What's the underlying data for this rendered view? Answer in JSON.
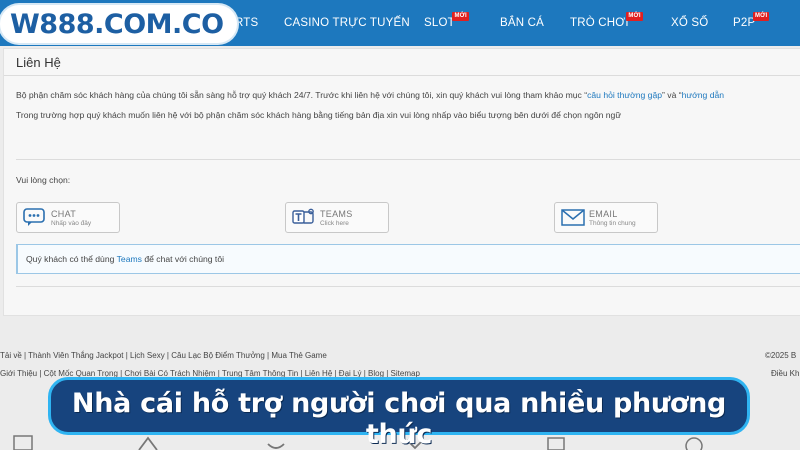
{
  "header": {
    "logo_text": "W888.COM.CO",
    "nav": [
      {
        "label": "RTS",
        "badge": ""
      },
      {
        "label": "CASINO TRỰC TUYẾN",
        "badge": ""
      },
      {
        "label": "SLOT",
        "badge": "MỚI"
      },
      {
        "label": "BẮN CÁ",
        "badge": ""
      },
      {
        "label": "TRÒ CHƠI",
        "badge": "MỚI"
      },
      {
        "label": "XỔ SỐ",
        "badge": ""
      },
      {
        "label": "P2P",
        "badge": "MỚI"
      }
    ]
  },
  "contact": {
    "title": "Liên Hệ",
    "para1_prefix": "Bộ phận chăm sóc khách hàng của chúng tôi sẵn sàng hỗ trợ quý khách 24/7. Trước khi liên hệ với chúng tôi, xin quý khách vui lòng tham khảo mục “",
    "para1_link1": "câu hỏi thường gặp",
    "para1_mid": "” và “",
    "para1_link2": "hướng dẫn",
    "para2": "Trong trường hợp quý khách muốn liên hệ với bộ phận chăm sóc khách hàng bằng tiếng bản địa xin vui lòng nhấp vào biểu tượng bên dưới để chọn ngôn ngữ",
    "choose_label": "Vui lòng chọn:",
    "options": [
      {
        "title": "CHAT",
        "sub": "Nhấp vào đây",
        "icon": "chat-icon"
      },
      {
        "title": "TEAMS",
        "sub": "Click here",
        "icon": "teams-icon"
      },
      {
        "title": "EMAIL",
        "sub": "Thông tin chung",
        "icon": "email-icon"
      }
    ],
    "notice_prefix": "Quý khách có thể dùng ",
    "notice_link": "Teams",
    "notice_suffix": " để chat với chúng tôi"
  },
  "footer": {
    "row1": "Tải về  |  Thành Viên Thắng Jackpot  |  Lịch Sexy  |  Câu Lạc Bộ Điểm Thưởng  |  Mua Thẻ Game",
    "row2": "Giới Thiệu  |  Cột Mốc Quan Trọng  |  Chơi Bài Có Trách Nhiệm  |  Trung Tâm Thông Tin  |  Liên Hệ  |  Đại Lý  |  Blog  |  Sitemap",
    "right1": "©2025 B",
    "right2": "Điều Kh"
  },
  "banner": {
    "text": "Nhà cái hỗ trợ người chơi qua nhiều phương thức"
  },
  "colors": {
    "nav_bg": "#1d78be",
    "link": "#1d78be",
    "banner_bg": "#17447e",
    "banner_border": "#2fb4f2",
    "badge": "#e02020"
  }
}
